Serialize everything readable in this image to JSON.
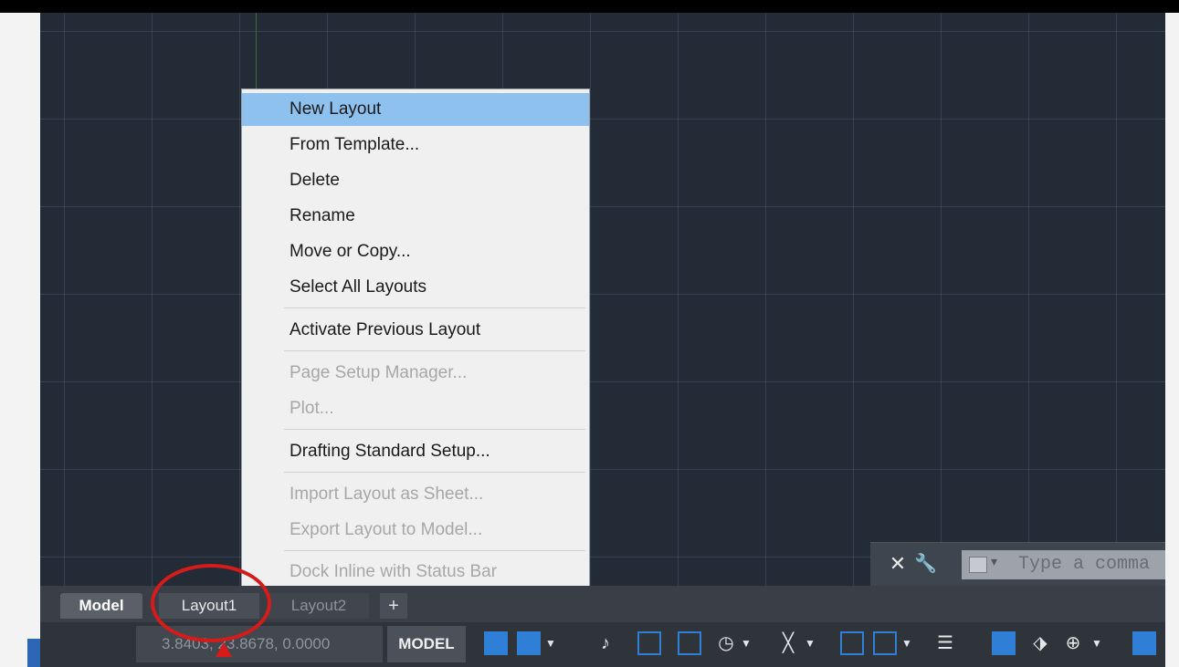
{
  "context_menu": {
    "items": [
      {
        "label": "New Layout",
        "state": "highlighted"
      },
      {
        "label": "From Template...",
        "state": "enabled"
      },
      {
        "label": "Delete",
        "state": "enabled"
      },
      {
        "label": "Rename",
        "state": "enabled"
      },
      {
        "label": "Move or Copy...",
        "state": "enabled"
      },
      {
        "label": "Select All Layouts",
        "state": "enabled"
      },
      {
        "label": "Activate Previous Layout",
        "state": "enabled"
      },
      {
        "label": "Page Setup Manager...",
        "state": "disabled"
      },
      {
        "label": "Plot...",
        "state": "disabled"
      },
      {
        "label": "Drafting Standard Setup...",
        "state": "enabled"
      },
      {
        "label": "Import Layout as Sheet...",
        "state": "disabled"
      },
      {
        "label": "Export Layout to Model...",
        "state": "disabled"
      },
      {
        "label": "Dock Inline with Status Bar",
        "state": "disabled"
      }
    ]
  },
  "command_line": {
    "placeholder": "Type a comma",
    "close_icon": "close-icon",
    "settings_icon": "wrench-icon"
  },
  "layout_tabs": {
    "model": "Model",
    "layout1": "Layout1",
    "layout2": "Layout2",
    "add": "+"
  },
  "status_bar": {
    "coordinates": "3.8403, 23.8678, 0.0000",
    "mode": "MODEL"
  },
  "colors": {
    "canvas": "#232b36",
    "menu_highlight": "#8fc1ef",
    "annotation": "#d71a1a",
    "status_accent": "#2f7fd6"
  }
}
